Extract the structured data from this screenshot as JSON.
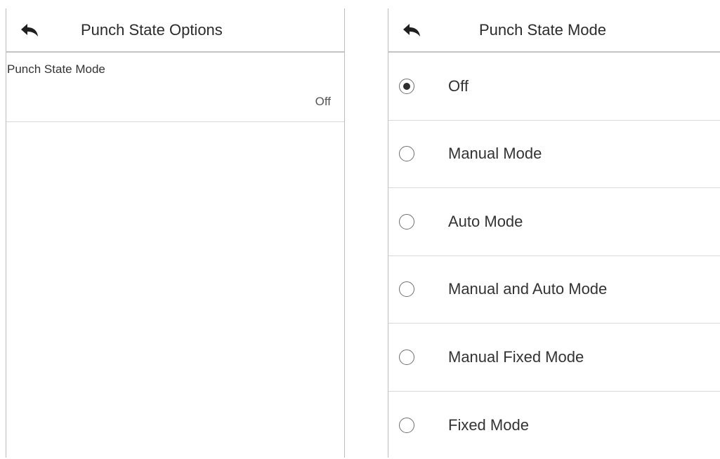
{
  "left_screen": {
    "title": "Punch State Options",
    "back_icon": "back-arrow-icon",
    "setting": {
      "label": "Punch State Mode",
      "value": "Off"
    }
  },
  "right_screen": {
    "title": "Punch State Mode",
    "back_icon": "back-arrow-icon",
    "selected_index": 0,
    "options": [
      {
        "label": "Off",
        "selected": true
      },
      {
        "label": "Manual Mode",
        "selected": false
      },
      {
        "label": "Auto Mode",
        "selected": false
      },
      {
        "label": "Manual and Auto Mode",
        "selected": false
      },
      {
        "label": "Manual Fixed Mode",
        "selected": false
      },
      {
        "label": "Fixed Mode",
        "selected": false
      }
    ]
  }
}
